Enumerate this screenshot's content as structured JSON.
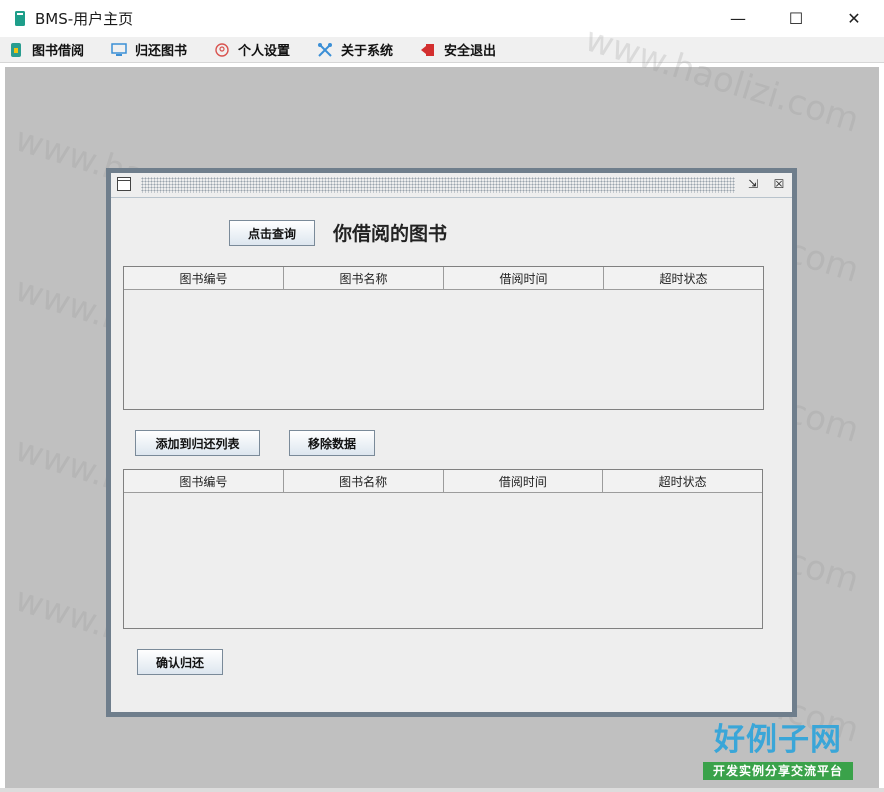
{
  "window": {
    "title": "BMS-用户主页",
    "minimize_glyph": "—",
    "maximize_glyph": "☐",
    "close_glyph": "✕"
  },
  "menu": [
    {
      "label": "图书借阅",
      "icon": "book-lock-icon",
      "color": "#2a9d8f"
    },
    {
      "label": "归还图书",
      "icon": "monitor-icon",
      "color": "#3b8fd6"
    },
    {
      "label": "个人设置",
      "icon": "user-circle-icon",
      "color": "#d9534f"
    },
    {
      "label": "关于系统",
      "icon": "tools-icon",
      "color": "#3b8fd6"
    },
    {
      "label": "安全退出",
      "icon": "exit-icon",
      "color": "#d32f2f"
    }
  ],
  "frame": {
    "restore_glyph": "⇲",
    "close_glyph": "☒"
  },
  "borrowed": {
    "query_button": "点击查询",
    "heading": "你借阅的图书",
    "columns": [
      "图书编号",
      "图书名称",
      "借阅时间",
      "超时状态"
    ]
  },
  "return_list": {
    "add_button": "添加到归还列表",
    "remove_button": "移除数据",
    "columns": [
      "图书编号",
      "图书名称",
      "借阅时间",
      "超时状态"
    ],
    "confirm_button": "确认归还"
  },
  "watermark": "www.haolizi.com",
  "logo": {
    "main": "好例子网",
    "sub": "开发实例分享交流平台"
  }
}
